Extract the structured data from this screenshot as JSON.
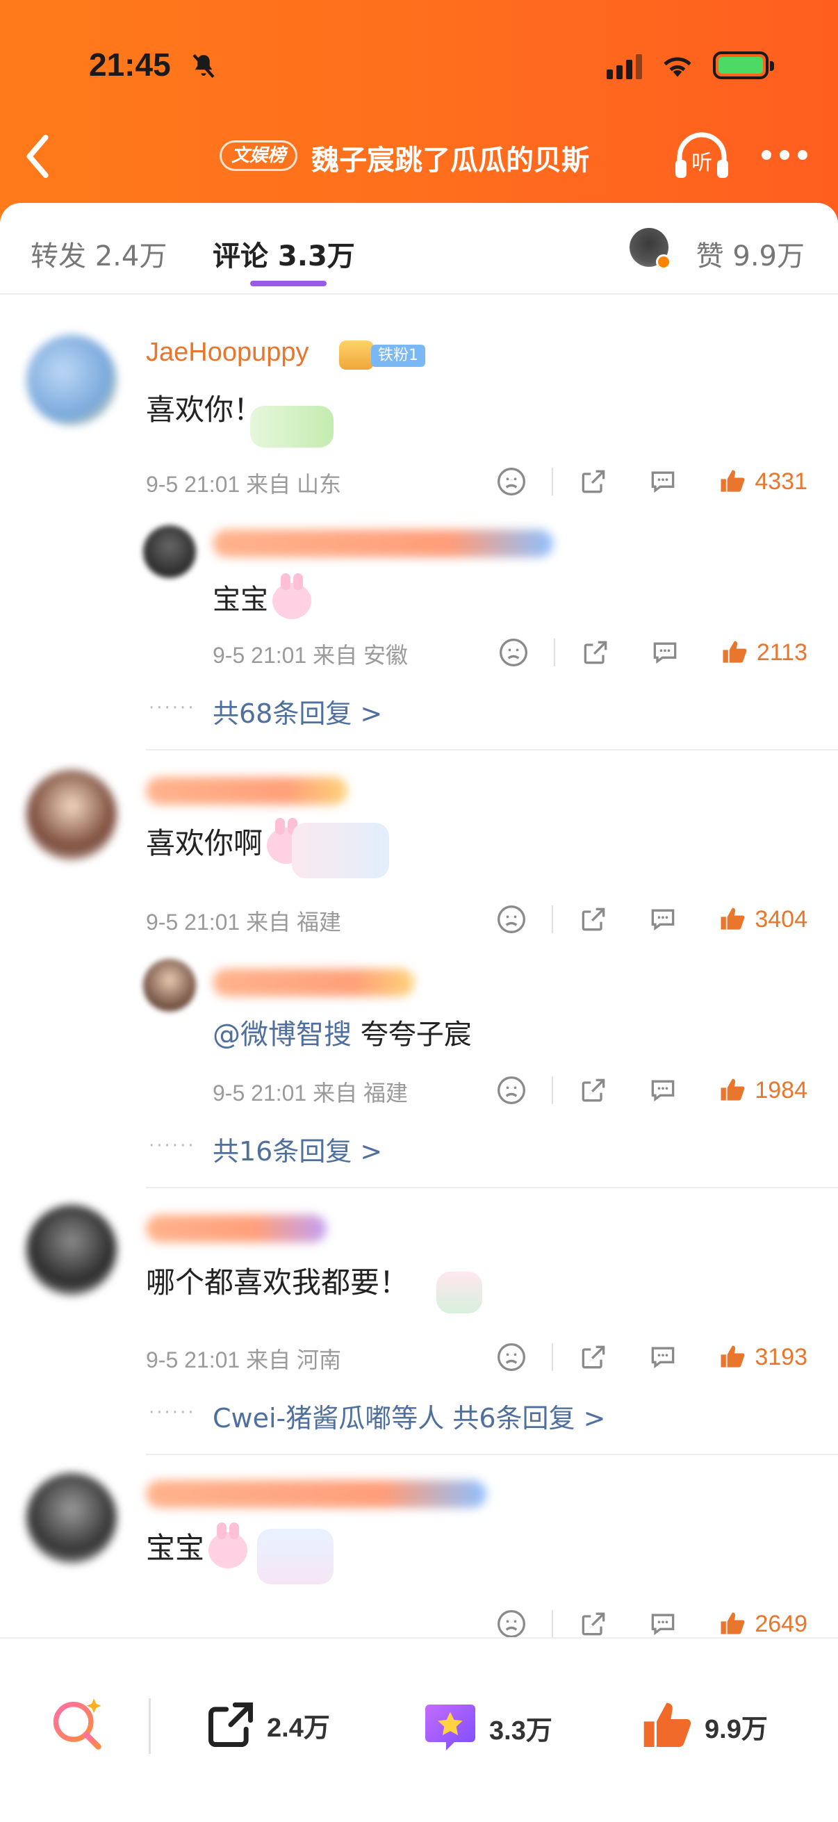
{
  "status_bar": {
    "time": "21:45"
  },
  "nav": {
    "hot_badge": "文娱榜",
    "title": "魏子宸跳了瓜瓜的贝斯"
  },
  "tabs": {
    "repost": "转发 2.4万",
    "comment": "评论 3.3万",
    "like": "赞 9.9万"
  },
  "comments": [
    {
      "username": "JaeHoopuppy",
      "fan_badge": "铁粉1",
      "text": "喜欢你！",
      "time": "9-5 21:01",
      "location": "来自 山东",
      "likes": "4331",
      "reply": {
        "text": "宝宝",
        "time": "9-5 21:01",
        "location": "来自 安徽",
        "likes": "2113"
      },
      "more_replies": "共68条回复 >"
    },
    {
      "text": "喜欢你啊",
      "time": "9-5 21:01",
      "location": "来自 福建",
      "likes": "3404",
      "reply": {
        "mention": "@微博智搜",
        "text": " 夸夸子宸",
        "time": "9-5 21:01",
        "location": "来自 福建",
        "likes": "1984"
      },
      "more_replies": "共16条回复 >"
    },
    {
      "text": "哪个都喜欢我都要！",
      "time": "9-5 21:01",
      "location": "来自 河南",
      "likes": "3193",
      "more_repliers": "Cwei-猪酱瓜嘟等人",
      "more_replies": "共6条回复 >"
    },
    {
      "text": "宝宝",
      "likes": "2649"
    }
  ],
  "bottom_bar": {
    "repost": "2.4万",
    "comment": "3.3万",
    "like": "9.9万"
  },
  "colors": {
    "accent_orange": "#ff6f1d",
    "tab_underline": "#9b59e8",
    "like": "#e8762c",
    "link": "#4f6f9f"
  }
}
